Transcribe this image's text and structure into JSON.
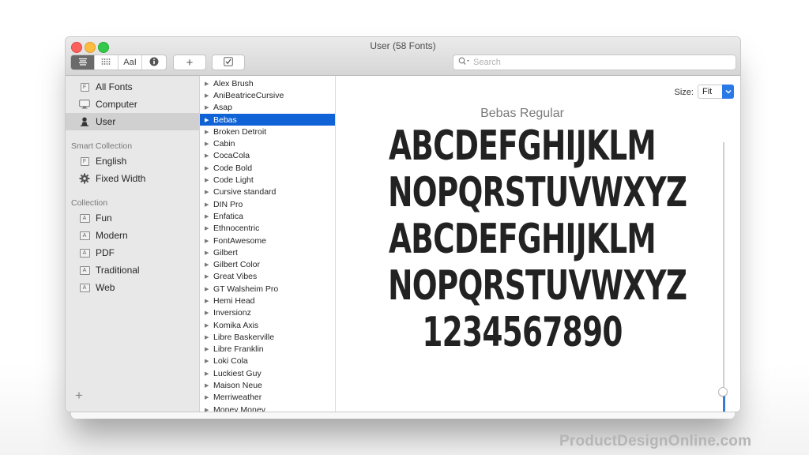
{
  "window": {
    "title": "User (58 Fonts)"
  },
  "toolbar": {
    "view_buttons": [
      {
        "name": "list-view",
        "icon": "list-icon",
        "glyph": "☰",
        "active": true
      },
      {
        "name": "grid-view",
        "icon": "grid-icon",
        "glyph": "⠿",
        "active": false
      },
      {
        "name": "sample-view",
        "icon": "sample-text-icon",
        "glyph": "AaI",
        "active": false
      },
      {
        "name": "info-view",
        "icon": "info-icon",
        "glyph": "i",
        "active": false
      }
    ],
    "add_glyph": "+",
    "validate_glyph": "☑",
    "search": {
      "placeholder": "Search",
      "value": ""
    }
  },
  "sidebar": {
    "library_items": [
      {
        "label": "All Fonts",
        "icon": "font-file-icon",
        "selected": false
      },
      {
        "label": "Computer",
        "icon": "computer-icon",
        "selected": false
      },
      {
        "label": "User",
        "icon": "user-icon",
        "selected": true
      }
    ],
    "smart_collection_header": "Smart Collection",
    "smart_collection_items": [
      {
        "label": "English",
        "icon": "font-file-icon"
      },
      {
        "label": "Fixed Width",
        "icon": "gear-icon"
      }
    ],
    "collection_header": "Collection",
    "collection_items": [
      {
        "label": "Fun",
        "icon": "collection-icon"
      },
      {
        "label": "Modern",
        "icon": "collection-icon"
      },
      {
        "label": "PDF",
        "icon": "collection-icon"
      },
      {
        "label": "Traditional",
        "icon": "collection-icon"
      },
      {
        "label": "Web",
        "icon": "collection-icon"
      }
    ],
    "add_glyph": "+"
  },
  "font_list": {
    "selected": "Bebas",
    "items": [
      "Alex Brush",
      "AniBeatriceCursive",
      "Asap",
      "Bebas",
      "Broken Detroit",
      "Cabin",
      "CocaCola",
      "Code Bold",
      "Code Light",
      "Cursive standard",
      "DIN Pro",
      "Enfatica",
      "Ethnocentric",
      "FontAwesome",
      "Gilbert",
      "Gilbert Color",
      "Great Vibes",
      "GT Walsheim Pro",
      "Hemi Head",
      "Inversionz",
      "Komika Axis",
      "Libre Baskerville",
      "Libre Franklin",
      "Loki Cola",
      "Luckiest Guy",
      "Maison Neue",
      "Merriweather",
      "Money Money"
    ]
  },
  "preview": {
    "size_label": "Size:",
    "size_value": "Fit",
    "font_name": "Bebas Regular",
    "sample_lines": [
      "ABCDEFGHIJKLM",
      "NOPQRSTUVWXYZ",
      "ABCDEFGHIJKLM",
      "NOPQRSTUVWXYZ",
      "1234567890"
    ],
    "size_slider_fraction": 0.85
  },
  "colors": {
    "selection_blue": "#0f63d6",
    "slider_blue": "#3a7bd5",
    "close": "#fc605c",
    "minimize": "#fdbc40",
    "maximize": "#34c84a"
  },
  "watermark": "ProductDesignOnline.com"
}
